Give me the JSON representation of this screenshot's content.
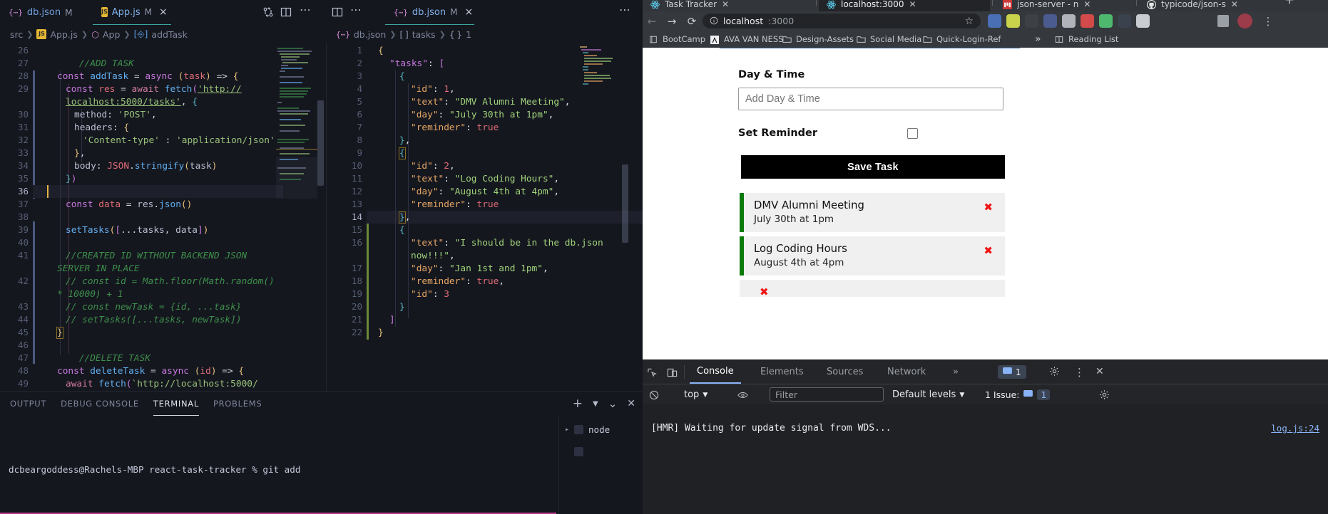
{
  "vscode": {
    "tabs": [
      {
        "icon": "json-file-icon",
        "name": "db.json",
        "modified": "M",
        "active": false
      },
      {
        "icon": "js-file-icon",
        "name": "App.js",
        "modified": "M",
        "active": true,
        "close": "×"
      }
    ],
    "split_tabs": [
      {
        "icon": "json-file-icon",
        "name": "db.json",
        "modified": "M",
        "active": true,
        "close": "×"
      }
    ],
    "breadcrumb_left": [
      "src",
      "App.js",
      "App",
      "addTask"
    ],
    "breadcrumb_right": [
      "db.json",
      "tasks",
      "1"
    ],
    "left_editor": {
      "first_line": 26,
      "lines": [
        {
          "n": 26,
          "text": ""
        },
        {
          "n": 27,
          "text": "    //ADD TASK"
        },
        {
          "n": 28,
          "text": "    const addTask = async (task) => {"
        },
        {
          "n": 29,
          "text": "      const res = await fetch('http://localhost:5000/tasks', {"
        },
        {
          "n": 30,
          "text": "        method: 'POST',"
        },
        {
          "n": 31,
          "text": "        headers: {"
        },
        {
          "n": 32,
          "text": "          'Content-type' : 'application/json'"
        },
        {
          "n": 33,
          "text": "        },"
        },
        {
          "n": 34,
          "text": "        body: JSON.stringify(task)"
        },
        {
          "n": 35,
          "text": "      })"
        },
        {
          "n": 36,
          "text": ""
        },
        {
          "n": 37,
          "text": "      const data = res.json()"
        },
        {
          "n": 38,
          "text": ""
        },
        {
          "n": 39,
          "text": "      setTasks([...tasks, data])"
        },
        {
          "n": 40,
          "text": ""
        },
        {
          "n": 41,
          "text": "      //CREATED ID WITHOUT BACKEND JSON SERVER IN PLACE"
        },
        {
          "n": 42,
          "text": "      // const id = Math.floor(Math.random() * 10000) + 1"
        },
        {
          "n": 43,
          "text": "      // const newTask = {id, ...task}"
        },
        {
          "n": 44,
          "text": "      // setTasks([...tasks, newTask])"
        },
        {
          "n": 45,
          "text": "    }"
        },
        {
          "n": 46,
          "text": ""
        },
        {
          "n": 47,
          "text": "    //DELETE TASK"
        },
        {
          "n": 48,
          "text": "    const deleteTask = async (id) => {"
        },
        {
          "n": 49,
          "text": "      await fetch(`http://localhost:5000/"
        }
      ]
    },
    "right_editor": {
      "lines": [
        {
          "n": 1,
          "text": "{"
        },
        {
          "n": 2,
          "text": "  \"tasks\": ["
        },
        {
          "n": 3,
          "text": "    {"
        },
        {
          "n": 4,
          "text": "      \"id\": 1,"
        },
        {
          "n": 5,
          "text": "      \"text\": \"DMV Alumni Meeting\","
        },
        {
          "n": 6,
          "text": "      \"day\": \"July 30th at 1pm\","
        },
        {
          "n": 7,
          "text": "      \"reminder\": true"
        },
        {
          "n": 8,
          "text": "    },"
        },
        {
          "n": 9,
          "text": "    {"
        },
        {
          "n": 10,
          "text": "      \"id\": 2,"
        },
        {
          "n": 11,
          "text": "      \"text\": \"Log Coding Hours\","
        },
        {
          "n": 12,
          "text": "      \"day\": \"August 4th at 4pm\","
        },
        {
          "n": 13,
          "text": "      \"reminder\": true"
        },
        {
          "n": 14,
          "text": "    },"
        },
        {
          "n": 15,
          "text": "    {"
        },
        {
          "n": 16,
          "text": "      \"text\": \"I should be in the db.json now!!!\","
        },
        {
          "n": 17,
          "text": "      \"day\": \"Jan 1st and 1pm\","
        },
        {
          "n": 18,
          "text": "      \"reminder\": true,"
        },
        {
          "n": 19,
          "text": "      \"id\": 3"
        },
        {
          "n": 20,
          "text": "    }"
        },
        {
          "n": 21,
          "text": "  ]"
        },
        {
          "n": 22,
          "text": "}"
        }
      ]
    },
    "panel": {
      "tabs": [
        "OUTPUT",
        "DEBUG CONSOLE",
        "TERMINAL",
        "PROBLEMS"
      ],
      "active_tab": "TERMINAL",
      "terminal_line": "dcbeargoddess@Rachels-MBP react-task-tracker % git add",
      "sidebar_items": [
        {
          "label": "node"
        }
      ],
      "add_label": "+",
      "chevron": "⌄",
      "close": "✕"
    }
  },
  "chrome": {
    "tabs": [
      {
        "title": "Task Tracker",
        "favicon": "react-icon",
        "active": false
      },
      {
        "title": "localhost:3000",
        "favicon": "react-icon",
        "active": true
      },
      {
        "title": "json-server - n",
        "favicon": "npm-icon",
        "active": false
      },
      {
        "title": "typicode/json-s",
        "favicon": "github-icon",
        "active": false
      }
    ],
    "new_tab_label": "+",
    "nav": {
      "back": "←",
      "forward": "→",
      "reload": "⟳"
    },
    "omnibox": {
      "info_icon": "info-icon",
      "host": "localhost",
      "path": ":3000",
      "star": "☆"
    },
    "bookmarks": [
      {
        "label": "BootCamp",
        "icon": "bookmark-icon"
      },
      {
        "label": "AVA VAN NESS",
        "icon": "ava-icon"
      },
      {
        "label": "Design-Assets",
        "icon": "folder-icon"
      },
      {
        "label": "Social Media",
        "icon": "folder-icon"
      },
      {
        "label": "Quick-Login-Ref",
        "icon": "folder-icon"
      }
    ],
    "bookmarks_overflow": "»",
    "reading_list": "Reading List",
    "profile_icon": "avatar-icon",
    "menu_icon": "kebab-icon"
  },
  "app": {
    "day_time_label": "Day & Time",
    "day_time_placeholder": "Add Day & Time",
    "reminder_label": "Set Reminder",
    "reminder_checked": false,
    "save_label": "Save Task",
    "tasks": [
      {
        "title": "DMV Alumni Meeting",
        "day": "July 30th at 1pm",
        "delete_icon": "✖"
      },
      {
        "title": "Log Coding Hours",
        "day": "August 4th at 4pm",
        "delete_icon": "✖"
      },
      {
        "title": "",
        "day": "",
        "delete_icon": "✖"
      }
    ]
  },
  "devtools": {
    "tabs": [
      "Console",
      "Elements",
      "Sources",
      "Network"
    ],
    "active_tab": "Console",
    "overflow": "»",
    "inspect_icon": "inspect-icon",
    "device_icon": "device-toolbar-icon",
    "messages_badge": "1",
    "settings_icon": "gear-icon",
    "kebab_icon": "kebab-icon",
    "close_icon": "close-icon",
    "clear_icon": "clear-console-icon",
    "eye_icon": "eye-icon",
    "context": "top",
    "filter_placeholder": "Filter",
    "levels": "Default levels",
    "issues_label": "1 Issue:",
    "issues_count": "1",
    "console_message": "[HMR] Waiting for update signal from WDS...",
    "console_source": "log.js:24"
  },
  "colors": {
    "accent_green": "#0b7a0b",
    "devtools_blue": "#8ab4f8",
    "delete_red": "#f01414",
    "vscode_active_tab": "#3aa8a0"
  }
}
